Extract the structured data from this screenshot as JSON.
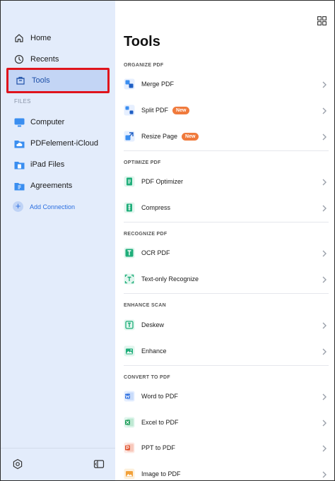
{
  "sidebar": {
    "nav": [
      {
        "label": "Home",
        "icon": "home-icon"
      },
      {
        "label": "Recents",
        "icon": "clock-icon"
      },
      {
        "label": "Tools",
        "icon": "toolbox-icon"
      }
    ],
    "files_label": "FILES",
    "files": [
      {
        "label": "Computer",
        "icon": "monitor-icon"
      },
      {
        "label": "PDFelement-iCloud",
        "icon": "cloud-folder-icon"
      },
      {
        "label": "iPad Files",
        "icon": "folder-icon"
      },
      {
        "label": "Agreements",
        "icon": "folder-icon"
      }
    ],
    "add_connection": "Add Connection"
  },
  "main": {
    "title": "Tools",
    "groups": [
      {
        "label": "ORGANIZE PDF",
        "items": [
          {
            "label": "Merge PDF",
            "badge": ""
          },
          {
            "label": "Split PDF",
            "badge": "New"
          },
          {
            "label": "Resize Page",
            "badge": "New"
          }
        ]
      },
      {
        "label": "OPTIMIZE PDF",
        "items": [
          {
            "label": "PDF Optimizer",
            "badge": ""
          },
          {
            "label": "Compress",
            "badge": ""
          }
        ]
      },
      {
        "label": "RECOGNIZE PDF",
        "items": [
          {
            "label": "OCR PDF",
            "badge": ""
          },
          {
            "label": "Text-only Recognize",
            "badge": ""
          }
        ]
      },
      {
        "label": "ENHANCE SCAN",
        "items": [
          {
            "label": "Deskew",
            "badge": ""
          },
          {
            "label": "Enhance",
            "badge": ""
          }
        ]
      },
      {
        "label": "CONVERT TO PDF",
        "items": [
          {
            "label": "Word to PDF",
            "badge": ""
          },
          {
            "label": "Excel to PDF",
            "badge": ""
          },
          {
            "label": "PPT to PDF",
            "badge": ""
          },
          {
            "label": "Image to PDF",
            "badge": ""
          }
        ]
      }
    ]
  },
  "colors": {
    "sidebar_bg": "#e3ecfb",
    "active_bg": "#c3d5f5",
    "highlight_border": "#e0141c",
    "accent": "#2c6fe0",
    "badge": "#f07a3c"
  }
}
